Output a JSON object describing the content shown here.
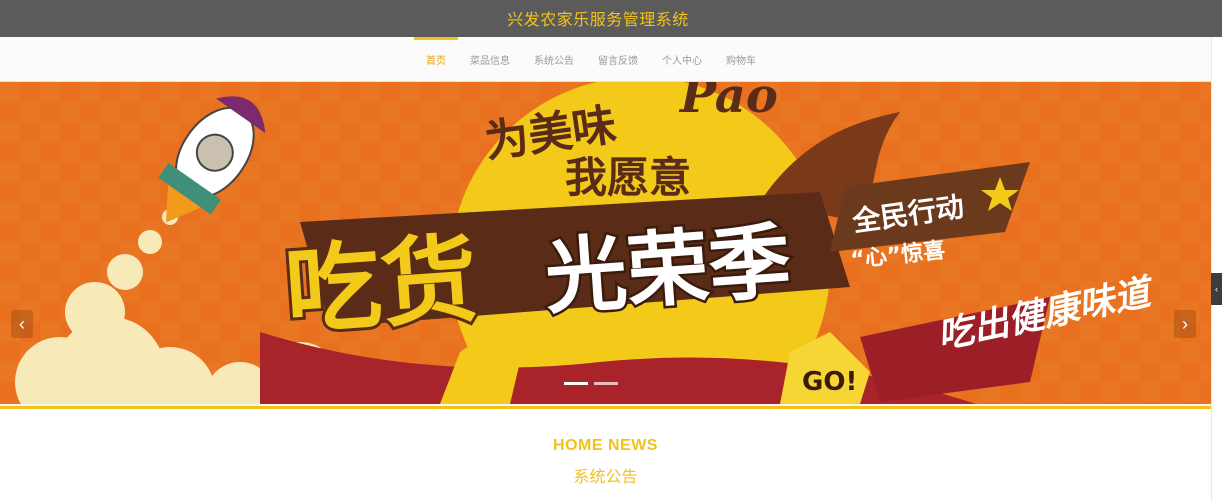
{
  "header": {
    "title": "兴发农家乐服务管理系统"
  },
  "nav": {
    "items": [
      {
        "label": "首页",
        "active": true
      },
      {
        "label": "菜品信息",
        "active": false
      },
      {
        "label": "系统公告",
        "active": false
      },
      {
        "label": "留言反馈",
        "active": false
      },
      {
        "label": "个人中心",
        "active": false
      },
      {
        "label": "购物车",
        "active": false
      }
    ]
  },
  "banner": {
    "line1": "为美味",
    "line1_extra": "Pao",
    "line2": "我愿意",
    "headline_a": "吃货",
    "headline_b": "光荣季",
    "tag": "全民行动",
    "sub": "“心”惊喜",
    "slogan": "吃出健康味道",
    "go": "GO!",
    "colors": {
      "background": "#e9711f",
      "accent": "#f2c21b",
      "brown": "#5a2c17"
    }
  },
  "carousel": {
    "prev": "‹",
    "next": "›",
    "slides": 2,
    "active_slide": 1
  },
  "news": {
    "title_en": "HOME NEWS",
    "title_cn": "系统公告"
  },
  "scroll_tab": {
    "glyph": "‹"
  }
}
